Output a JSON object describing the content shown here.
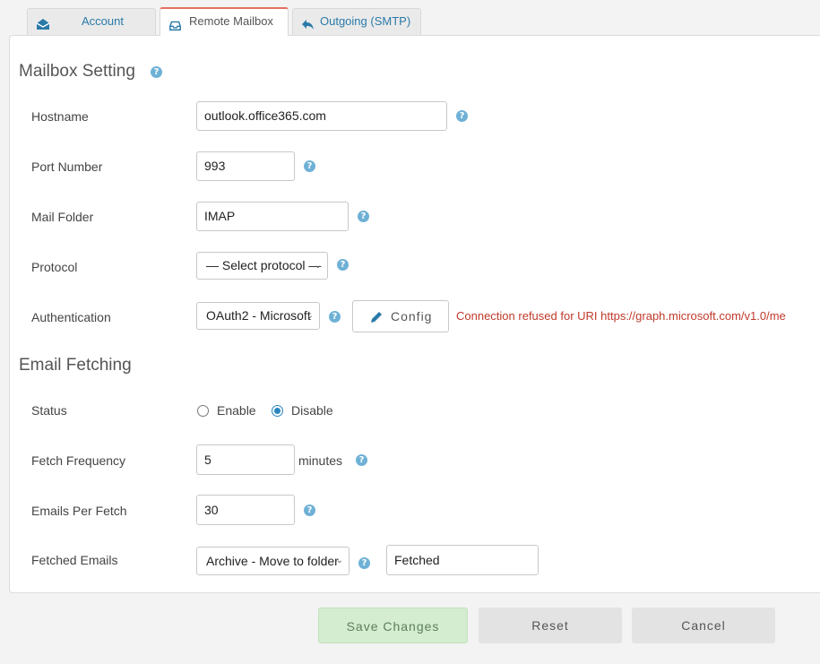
{
  "tabs": [
    {
      "label": "Account",
      "icon": "envelope-open-icon"
    },
    {
      "label": "Remote Mailbox",
      "icon": "inbox-icon"
    },
    {
      "label": "Outgoing (SMTP)",
      "icon": "reply-icon"
    }
  ],
  "mailbox": {
    "title": "Mailbox Setting",
    "hostname_label": "Hostname",
    "hostname_value": "outlook.office365.com",
    "port_label": "Port Number",
    "port_value": "993",
    "folder_label": "Mail Folder",
    "folder_value": "IMAP",
    "protocol_label": "Protocol",
    "protocol_value": "— Select protocol —",
    "auth_label": "Authentication",
    "auth_value": "OAuth2 - Microsoft",
    "config_label": "Config",
    "error_text": "Connection refused for URI https://graph.microsoft.com/v1.0/me"
  },
  "fetching": {
    "title": "Email Fetching",
    "status_label": "Status",
    "enable_label": "Enable",
    "disable_label": "Disable",
    "status_selected": "Disable",
    "frequency_label": "Fetch Frequency",
    "frequency_value": "5",
    "frequency_unit": "minutes",
    "per_fetch_label": "Emails Per Fetch",
    "per_fetch_value": "30",
    "fetched_label": "Fetched Emails",
    "fetched_action": "Archive - Move to folder",
    "fetched_folder": "Fetched"
  },
  "actions": {
    "save": "Save Changes",
    "reset": "Reset",
    "cancel": "Cancel"
  },
  "colors": {
    "accent": "#2a7aa8",
    "error": "#c0392b",
    "save_bg": "#d4ecd0",
    "help": "#6fb1d6"
  }
}
